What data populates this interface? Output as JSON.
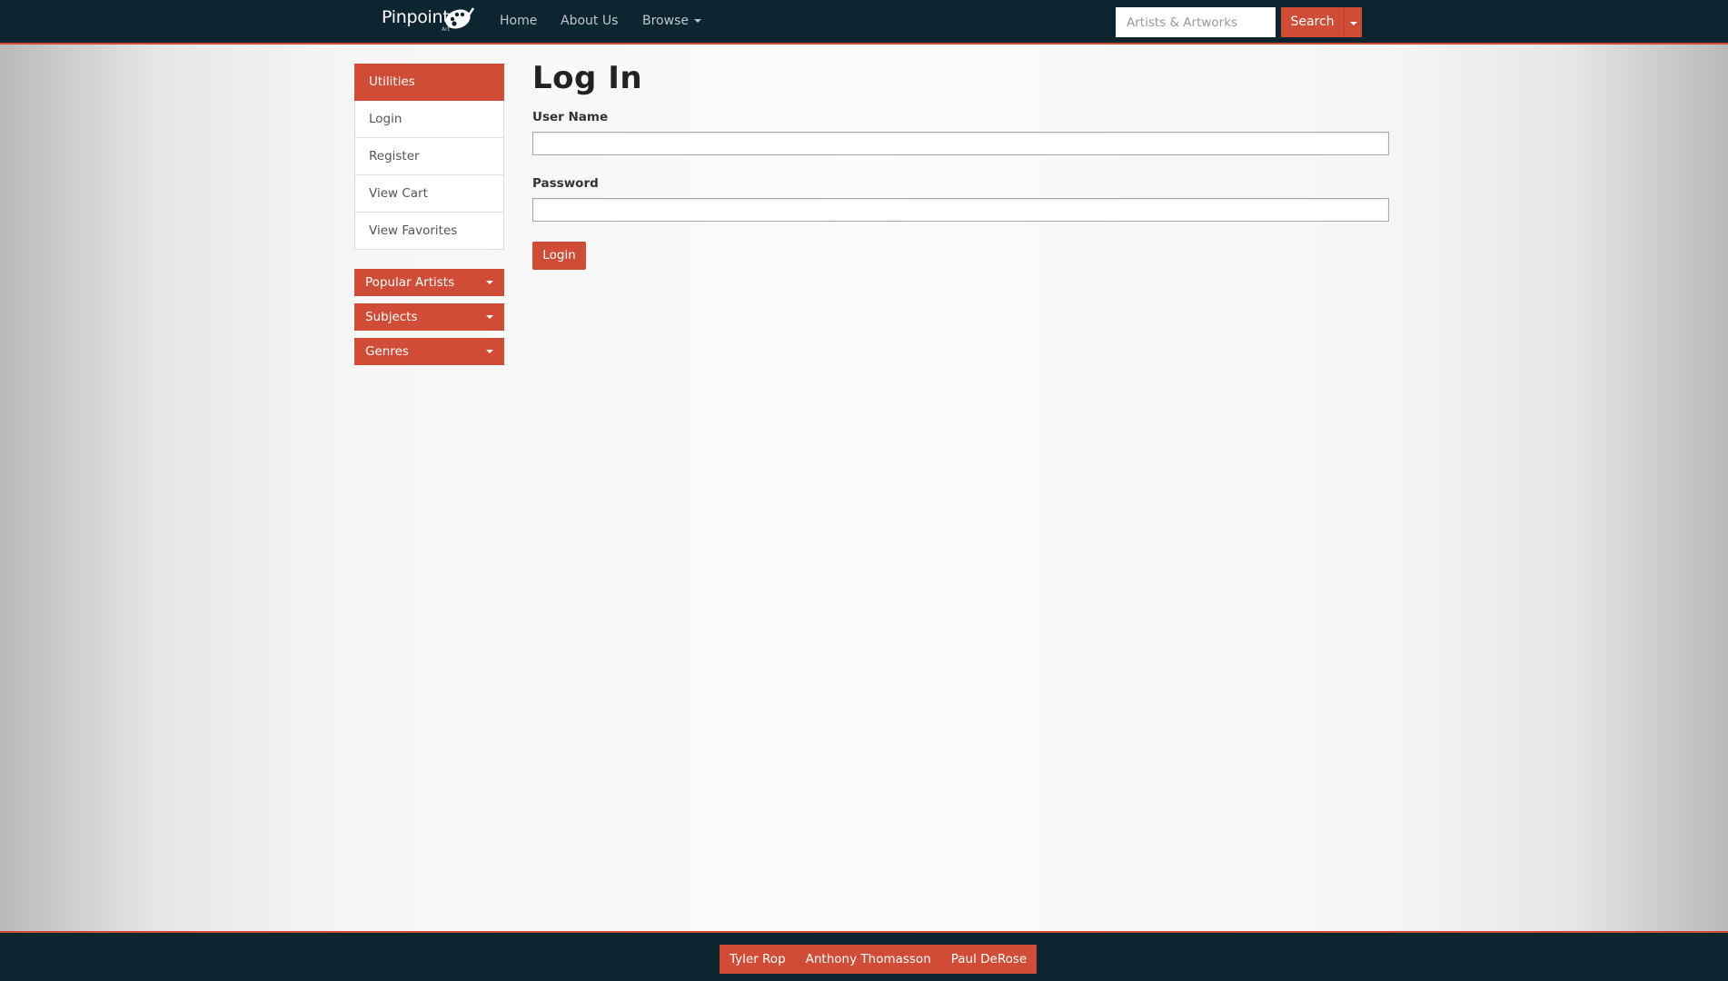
{
  "nav": {
    "brand_name": "Pinpoint",
    "brand_sub": "Art",
    "links": [
      "Home",
      "About Us",
      "Browse"
    ],
    "search_placeholder": "Artists & Artworks",
    "search_label": "Search"
  },
  "sidebar": {
    "panel_title": "Utilities",
    "items": [
      "Login",
      "Register",
      "View Cart",
      "View Favorites"
    ],
    "dropdowns": [
      "Popular Artists",
      "Subjects",
      "Genres"
    ]
  },
  "main": {
    "title": "Log In",
    "username_label": "User Name",
    "username_value": "",
    "password_label": "Password",
    "password_value": "",
    "login_label": "Login"
  },
  "footer": {
    "credits": [
      "Tyler Rop",
      "Anthony Thomasson",
      "Paul DeRose"
    ]
  },
  "colors": {
    "accent": "#d04c36",
    "navbar": "#0c2530"
  },
  "icons": {
    "brand": "palette-icon",
    "caret": "chevron-down-icon"
  }
}
